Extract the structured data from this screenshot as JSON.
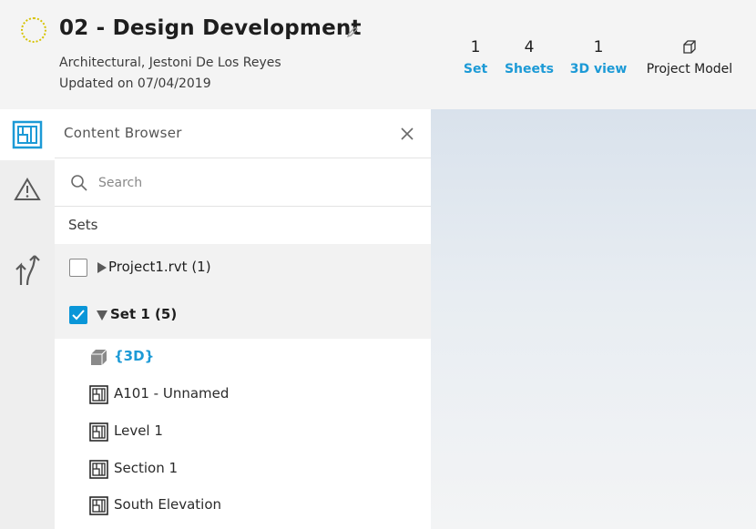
{
  "header": {
    "title": "02 - Design Development",
    "subtitle": "Architectural, Jestoni De Los Reyes",
    "updated": "Updated on 07/04/2019",
    "status_color": "#d6c200",
    "stats": {
      "set": {
        "count": "1",
        "label": "Set"
      },
      "sheets": {
        "count": "4",
        "label": "Sheets"
      },
      "view3d": {
        "count": "1",
        "label": "3D view"
      },
      "model": {
        "label": "Project Model",
        "icon": "cube-outline-icon"
      }
    }
  },
  "rail": {
    "items": [
      {
        "name": "sheet-browser-icon",
        "active": true
      },
      {
        "name": "warning-icon",
        "active": false
      },
      {
        "name": "compare-icon",
        "active": false
      }
    ]
  },
  "panel": {
    "title": "Content Browser",
    "search_placeholder": "Search",
    "sets_label": "Sets",
    "sets": [
      {
        "name": "Project1.rvt (1)",
        "checked": false,
        "expanded": false
      },
      {
        "name": "Set 1 (5)",
        "checked": true,
        "expanded": true
      }
    ],
    "items": [
      {
        "label": "{3D}",
        "icon": "cube-3d-icon",
        "highlighted": true
      },
      {
        "label": "A101 - Unnamed",
        "icon": "sheet-icon"
      },
      {
        "label": "Level 1",
        "icon": "sheet-icon"
      },
      {
        "label": "Section 1",
        "icon": "sheet-icon"
      },
      {
        "label": "South Elevation",
        "icon": "sheet-icon"
      }
    ]
  },
  "colors": {
    "accent": "#1c9ad6",
    "checkbox": "#0a96d8",
    "header_bg": "#f4f4f4",
    "rail_bg": "#eeeeee"
  }
}
